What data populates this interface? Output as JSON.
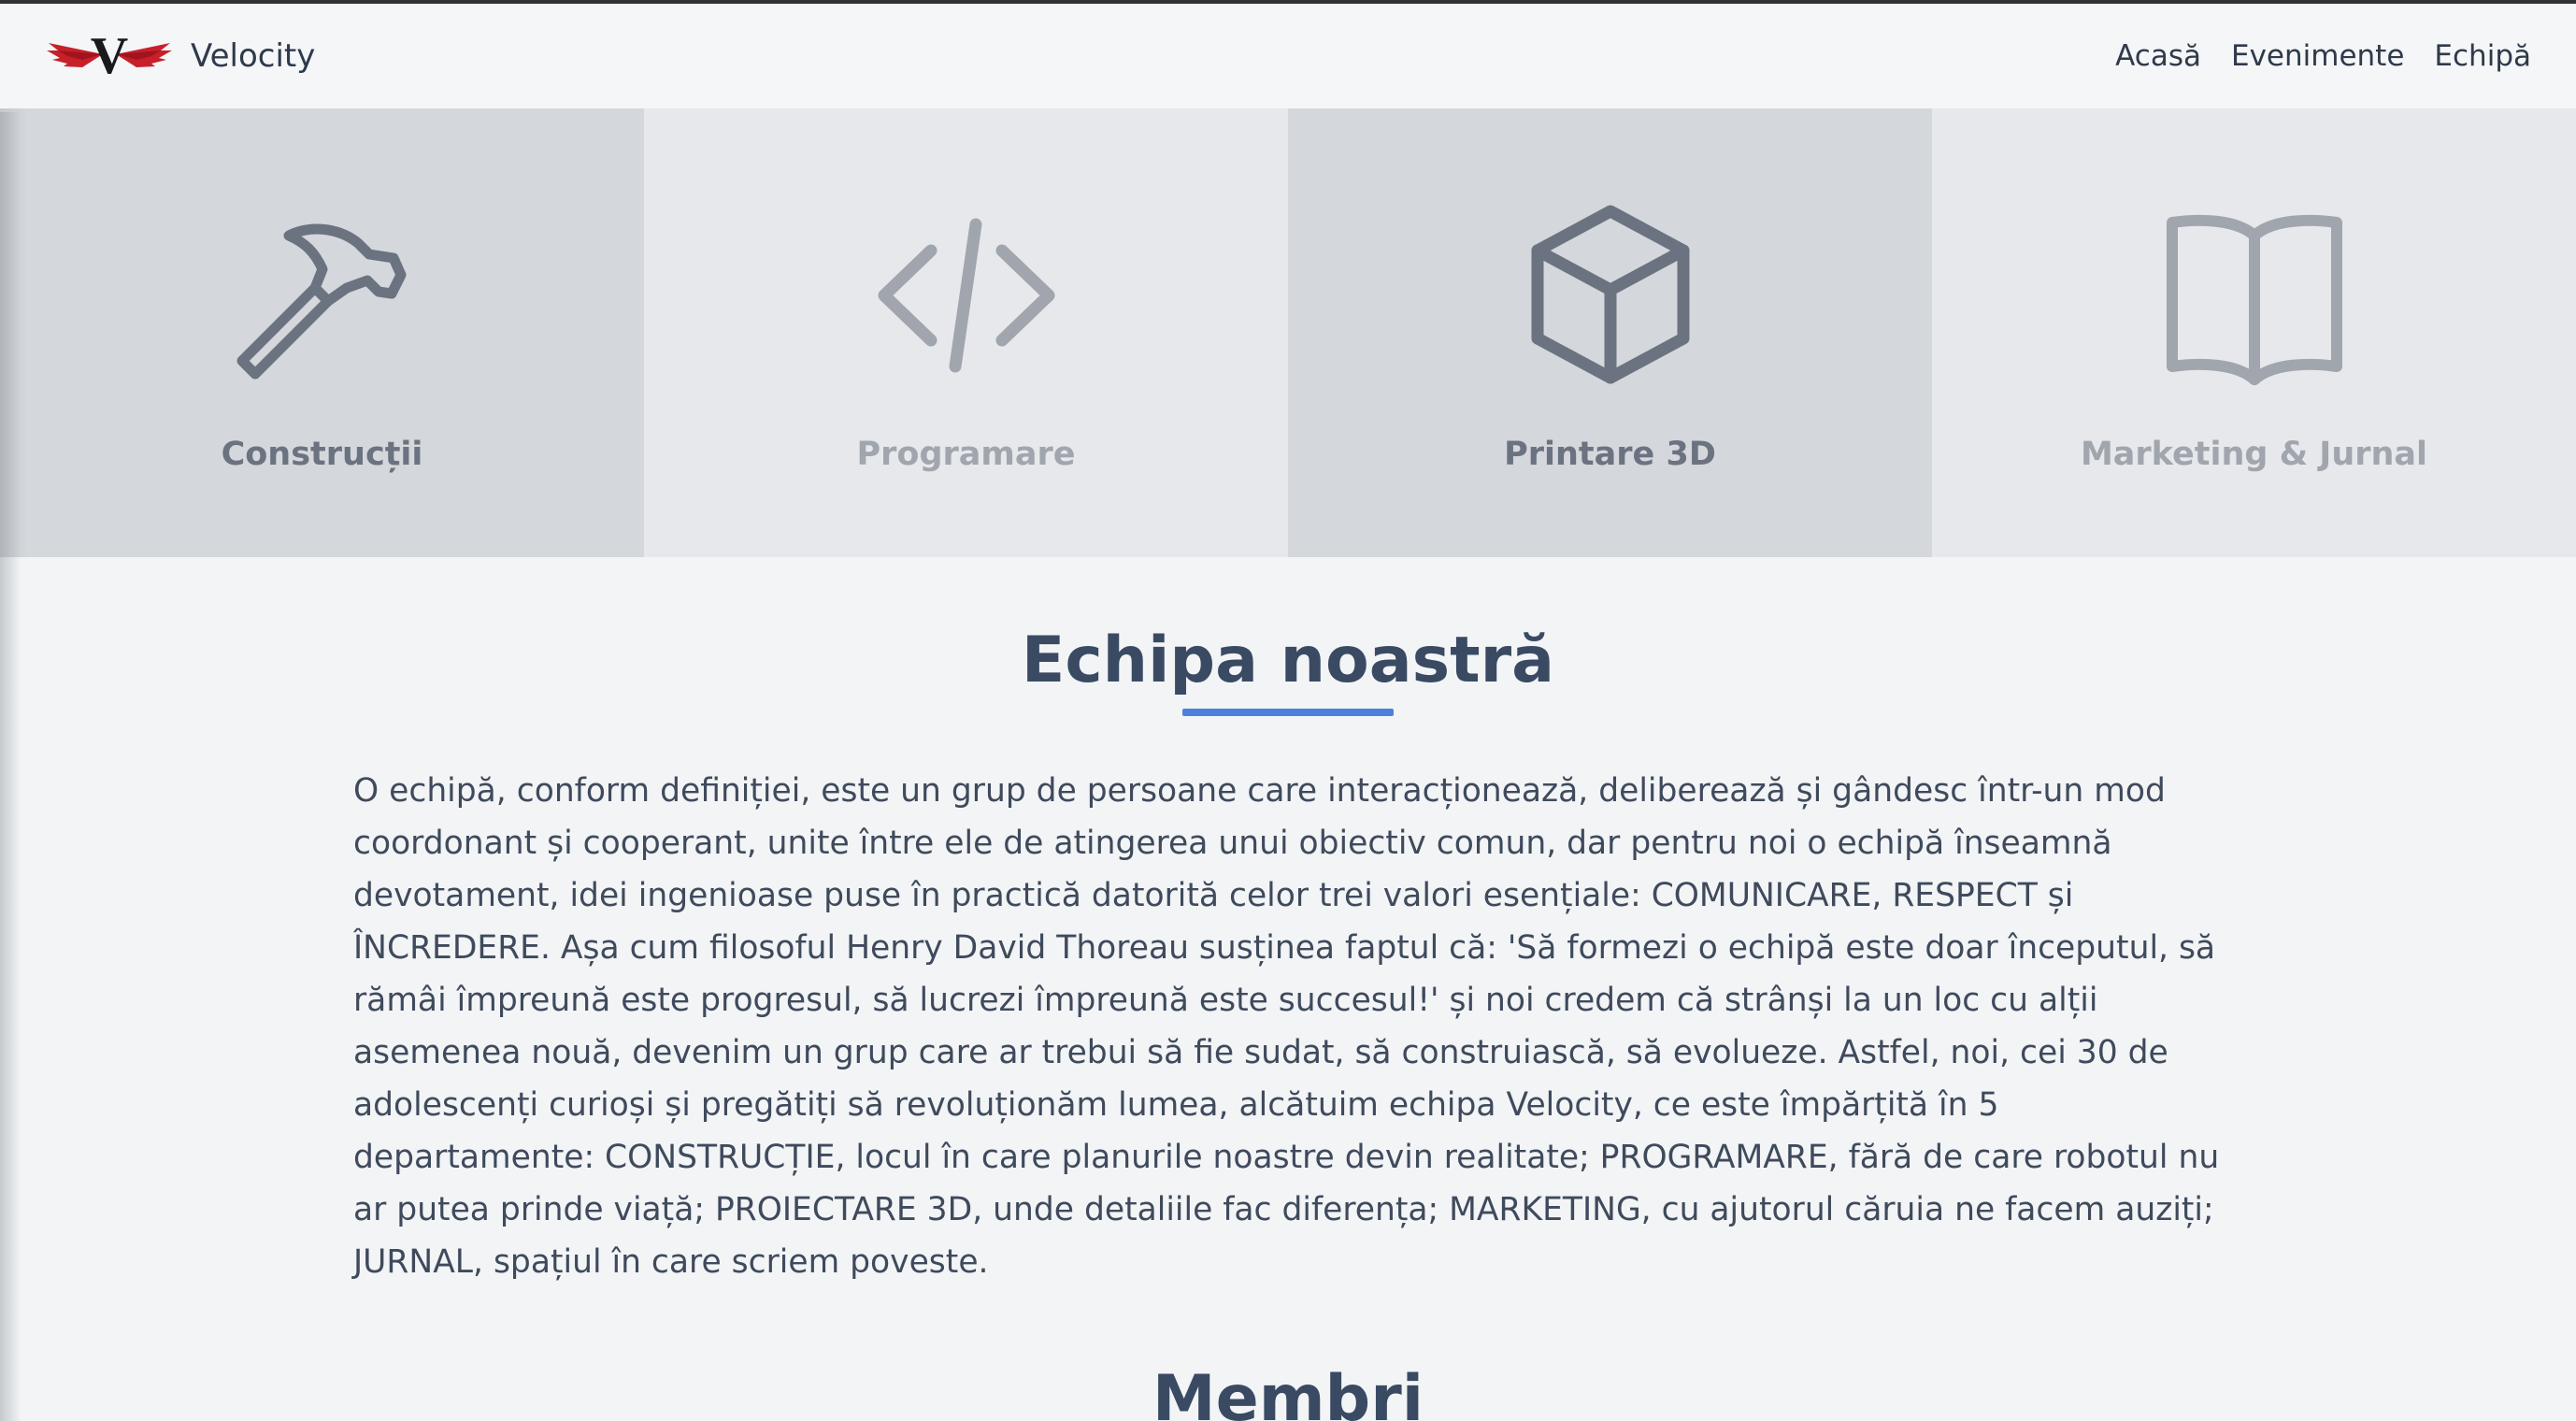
{
  "brand": {
    "name": "Velocity",
    "logo_letter": "V"
  },
  "nav": {
    "links": [
      "Acasă",
      "Evenimente",
      "Echipă"
    ]
  },
  "departments": [
    {
      "label": "Construcții",
      "icon": "hammer-icon",
      "style": "dark"
    },
    {
      "label": "Programare",
      "icon": "code-icon",
      "style": "light"
    },
    {
      "label": "Printare 3D",
      "icon": "cube-icon",
      "style": "dark"
    },
    {
      "label": "Marketing & Jurnal",
      "icon": "book-open-icon",
      "style": "light"
    }
  ],
  "team": {
    "title": "Echipa noastră",
    "paragraph": "O echipă, conform definiției, este un grup de persoane care interacționează, deliberează și gândesc într-un mod coordonant și cooperant, unite între ele de atingerea unui obiectiv comun, dar pentru noi o echipă înseamnă devotament, idei ingenioase puse în practică datorită celor trei valori esențiale: COMUNICARE, RESPECT și ÎNCREDERE. Așa cum filosoful Henry David Thoreau susținea faptul că: 'Să formezi o echipă este doar începutul, să rămâi împreună este progresul, să lucrezi împreună este succesul!' și noi credem că strânși la un loc cu alții asemenea nouă, devenim un grup care ar trebui să fie sudat, să construiască, să evolueze. Astfel, noi, cei 30 de adolescenți curioși și pregătiți să revoluționăm lumea, alcătuim echipa Velocity, ce este împărțită în 5 departamente: CONSTRUCȚIE, locul în care planurile noastre devin realitate; PROGRAMARE, fără de care robotul nu ar putea prinde viață; PROIECTARE 3D, unde detaliile fac diferența; MARKETING, cu ajutorul căruia ne facem auziți; JURNAL, spațiul în care scriem poveste."
  },
  "members": {
    "title": "Membri"
  },
  "colors": {
    "accent": "#4f7fdd",
    "heading": "#3a4a63",
    "logo_red": "#c8202a"
  }
}
